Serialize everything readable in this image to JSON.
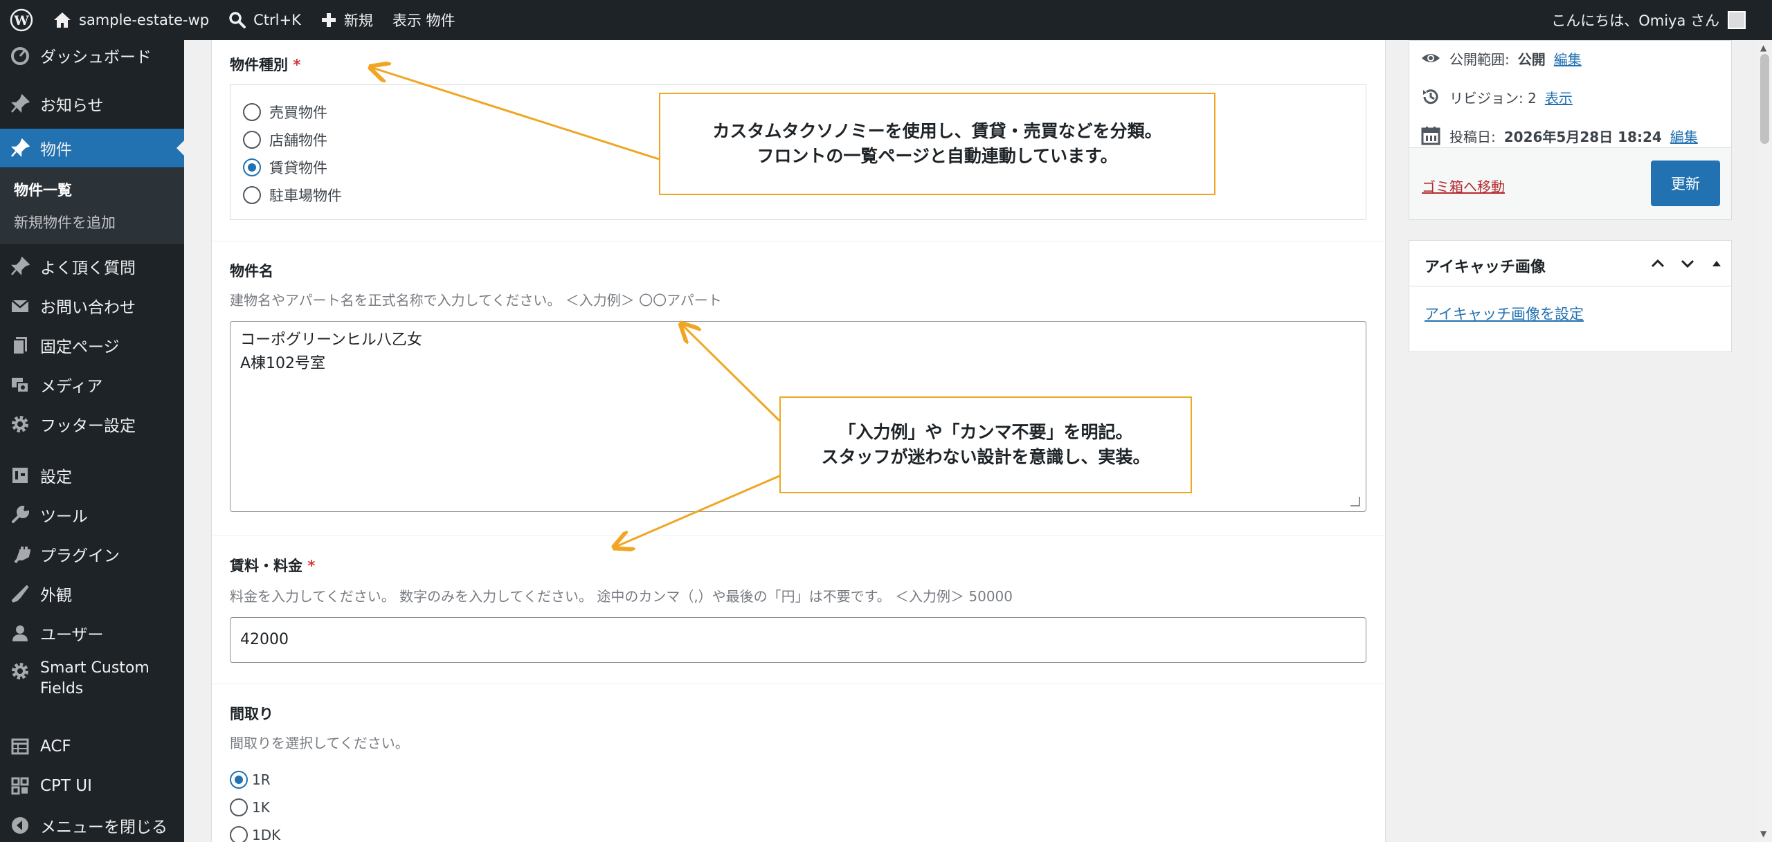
{
  "adminbar": {
    "site_name": "sample-estate-wp",
    "search_shortcut": "Ctrl+K",
    "new_label": "新規",
    "view_label": "表示 物件",
    "greeting": "こんにちは、Omiya さん"
  },
  "sidebar": {
    "dashboard": "ダッシュボード",
    "news": "お知らせ",
    "property": "物件",
    "sub_list": "物件一覧",
    "sub_add": "新規物件を追加",
    "faq": "よく頂く質問",
    "contact": "お問い合わせ",
    "pages": "固定ページ",
    "media": "メディア",
    "footer": "フッター設定",
    "settings": "設定",
    "tools": "ツール",
    "plugins": "プラグイン",
    "appearance": "外観",
    "users": "ユーザー",
    "scf_line1": "Smart Custom",
    "scf_line2": "Fields",
    "acf": "ACF",
    "cptui": "CPT UI",
    "collapse": "メニューを閉じる"
  },
  "fields": {
    "type_label": "物件種別",
    "required_mark": "*",
    "type_options": [
      "売買物件",
      "店舗物件",
      "賃貸物件",
      "駐車場物件"
    ],
    "type_selected": "賃貸物件",
    "name_label": "物件名",
    "name_help": "建物名やアパート名を正式名称で入力してください。 ＜入力例＞ 〇〇アパート",
    "name_value": "コーポグリーンヒル八乙女\nA棟102号室",
    "rent_label": "賃料・料金",
    "rent_help": "料金を入力してください。 数字のみを入力してください。 途中のカンマ（,）や最後の「円」は不要です。 ＜入力例＞ 50000",
    "rent_value": "42000",
    "layout_label": "間取り",
    "layout_help": "間取りを選択してください。",
    "layout_options": [
      "1R",
      "1K",
      "1DK"
    ],
    "layout_selected": "1R"
  },
  "callouts": {
    "top": "カスタムタクソノミーを使用し、賃貸・売買などを分類。\nフロントの一覧ページと自動連動しています。",
    "middle": "「入力例」や「カンマ不要」を明記。\nスタッフが迷わない設計を意識し、実装。"
  },
  "publish": {
    "visibility_label": "公開範囲:",
    "visibility_value": "公開",
    "edit": "編集",
    "revisions_label": "リビジョン: 2",
    "show": "表示",
    "date_label": "投稿日:",
    "date_value": "2026年5月28日 18:24",
    "trash": "ゴミ箱へ移動",
    "update": "更新"
  },
  "featured": {
    "title": "アイキャッチ画像",
    "set_link": "アイキャッチ画像を設定"
  },
  "colors": {
    "admin_dark": "#1d2327",
    "accent": "#2271b1",
    "callout_border": "#f0a623",
    "danger": "#b32d2e"
  }
}
